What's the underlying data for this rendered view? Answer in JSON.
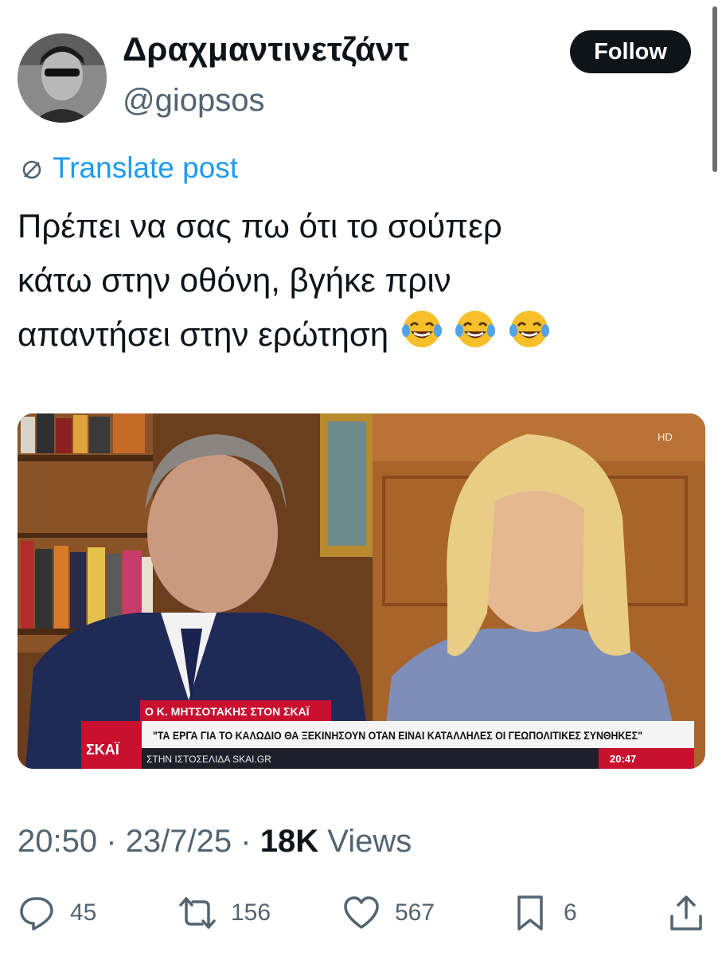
{
  "user": {
    "display_name": "Δραχμαντινετζάντ",
    "handle": "@giopsos",
    "follow_label": "Follow"
  },
  "translate_label": "Translate post",
  "tweet": {
    "lines": [
      "Πρέπει να σας πω ότι το σούπερ",
      "κάτω στην οθόνη, βγήκε πριν",
      "απαντήσει στην ερώτηση"
    ],
    "emoji": [
      "😂",
      "😂",
      "😂"
    ]
  },
  "media": {
    "hd_badge": "HD",
    "channel_logo": "ΣΚΑΪ",
    "ticker_title": "Ο Κ. ΜΗΤΣΟΤΑΚΗΣ ΣΤΟΝ ΣΚΑΪ",
    "ticker_quote": "\"ΤΑ ΕΡΓΑ ΓΙΑ ΤΟ ΚΑΛΩΔΙΟ ΘΑ ΞΕΚΙΝΗΣΟΥΝ ΟΤΑΝ ΕΙΝΑΙ ΚΑΤΑΛΛΗΛΕΣ ΟΙ ΓΕΩΠΟΛΙΤΙΚΕΣ ΣΥΝΘΗΚΕΣ\"",
    "ticker_sub": "ΣΤΗΝ ΙΣΤΟΣΕΛΙΔΑ SKAI.GR",
    "ticker_time": "20:47"
  },
  "meta": {
    "time": "20:50",
    "date": "23/7/25",
    "views_count": "18K",
    "views_label": "Views",
    "separator": "·"
  },
  "actions": {
    "replies": "45",
    "reposts": "156",
    "likes": "567",
    "bookmarks": "6"
  },
  "colors": {
    "accent": "#1d9bf0",
    "muted": "#536471",
    "text": "#0f1419",
    "skai_red": "#c8102e"
  }
}
